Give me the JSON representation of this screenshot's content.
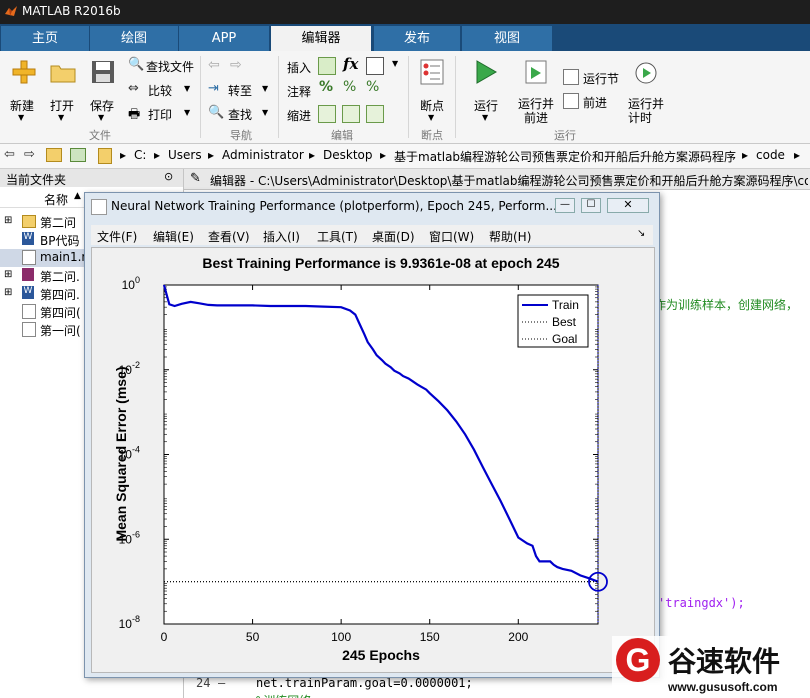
{
  "window": {
    "title": "MATLAB R2016b"
  },
  "tabs": [
    {
      "label": "主页"
    },
    {
      "label": "绘图"
    },
    {
      "label": "APP"
    },
    {
      "label": "编辑器"
    },
    {
      "label": "发布"
    },
    {
      "label": "视图"
    }
  ],
  "ribbon": {
    "file": {
      "new": "新建",
      "open": "打开",
      "save": "保存",
      "find_files": "查找文件",
      "compare": "比较",
      "print": "打印",
      "group": "文件"
    },
    "nav": {
      "goto": "转至",
      "find": "查找",
      "group": "导航"
    },
    "edit": {
      "insert": "插入",
      "comment": "注释",
      "indent": "缩进",
      "group": "编辑",
      "fx": "fx"
    },
    "breakpoints": {
      "label": "断点",
      "group": "断点"
    },
    "run": {
      "run": "运行",
      "run_advance": "运行并\n前进",
      "run_section": "运行节",
      "advance": "前进",
      "run_time": "运行并\n计时",
      "group": "运行"
    }
  },
  "address": {
    "crumbs": [
      "C:",
      "Users",
      "Administrator",
      "Desktop",
      "基于matlab编程游轮公司预售票定价和开船后升舱方案源码程序",
      "code"
    ]
  },
  "current_folder": {
    "title": "当前文件夹",
    "col_name": "名称",
    "files": [
      {
        "name": "第二问"
      },
      {
        "name": "BP代码"
      },
      {
        "name": "main1.m"
      },
      {
        "name": "第二问."
      },
      {
        "name": "第四问."
      },
      {
        "name": "第四问("
      },
      {
        "name": "第一问("
      }
    ]
  },
  "editor": {
    "title": "编辑器 - C:\\Users\\Administrator\\Desktop\\基于matlab编程游轮公司预售票定价和开船后升舱方案源码程序\\co",
    "line_24_num": "24",
    "line_24_dash": "—",
    "line_24_code": "net.trainParam.goal=0.0000001;",
    "line_25_code": "%训练网络",
    "comment_fragment": "作为训练样本，创建网络，",
    "code_fragment": "'traingdx');"
  },
  "figure": {
    "title": "Neural Network Training Performance (plotperform), Epoch 245, Perform...",
    "menus": [
      "文件(F)",
      "编辑(E)",
      "查看(V)",
      "插入(I)",
      "工具(T)",
      "桌面(D)",
      "窗口(W)",
      "帮助(H)"
    ]
  },
  "chart_data": {
    "type": "line",
    "title": "Best Training Performance is 9.9361e-08 at epoch 245",
    "xlabel": "245 Epochs",
    "ylabel": "Mean Squared Error  (mse)",
    "xlim": [
      0,
      245
    ],
    "ylim": [
      1e-08,
      1
    ],
    "yscale": "log",
    "xticks": [
      0,
      50,
      100,
      150,
      200
    ],
    "yticks": [
      {
        "base": "10",
        "exp": "0"
      },
      {
        "base": "10",
        "exp": "-2"
      },
      {
        "base": "10",
        "exp": "-4"
      },
      {
        "base": "10",
        "exp": "-6"
      },
      {
        "base": "10",
        "exp": "-8"
      }
    ],
    "legend_position": "top-right",
    "series": [
      {
        "name": "Train",
        "style": "solid",
        "color": "#0000cc",
        "x": [
          0,
          3,
          6,
          10,
          15,
          20,
          25,
          30,
          40,
          50,
          60,
          70,
          80,
          90,
          100,
          105,
          108,
          110,
          113,
          115,
          118,
          120,
          123,
          125,
          128,
          130,
          133,
          135,
          138,
          140,
          143,
          145,
          148,
          150,
          155,
          160,
          165,
          170,
          175,
          180,
          185,
          190,
          195,
          200,
          205,
          208,
          210,
          212,
          215,
          218,
          220,
          222,
          225,
          230,
          235,
          240,
          245
        ],
        "y": [
          1,
          0.35,
          0.32,
          0.36,
          0.4,
          0.37,
          0.34,
          0.33,
          0.33,
          0.33,
          0.32,
          0.32,
          0.32,
          0.31,
          0.3,
          0.25,
          0.2,
          0.13,
          0.07,
          0.045,
          0.03,
          0.022,
          0.017,
          0.014,
          0.0115,
          0.0095,
          0.0082,
          0.0071,
          0.0062,
          0.0055,
          0.0045,
          0.004,
          0.0034,
          0.0028,
          0.0018,
          0.0011,
          0.0006,
          0.0003,
          0.00013,
          5e-05,
          2e-05,
          8e-06,
          3e-06,
          1.1e-06,
          8e-07,
          7e-07,
          4e-07,
          3e-07,
          3e-07,
          3e-07,
          2.5e-07,
          2.2e-07,
          2e-07,
          1.8e-07,
          1.4e-07,
          1.2e-07,
          9.9361e-08
        ]
      },
      {
        "name": "Best",
        "style": "dotted",
        "color": "#000000",
        "x": [
          0,
          245
        ],
        "y": [
          9.9361e-08,
          9.9361e-08
        ]
      },
      {
        "name": "Goal",
        "style": "dotted",
        "color": "#000000",
        "x": [
          0,
          245
        ],
        "y": [
          1e-07,
          1e-07
        ]
      }
    ],
    "marker": {
      "x": 245,
      "y": 9.9361e-08
    }
  },
  "brand": {
    "name": "谷速软件",
    "url": "www.gususoft.com",
    "letter": "G"
  },
  "colors": {
    "accent": "#2f6fa6",
    "train": "#0000cc",
    "tab_bar": "#1a4a78"
  }
}
